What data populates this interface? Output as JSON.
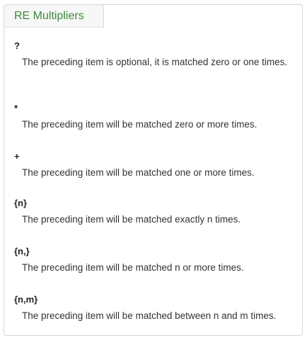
{
  "tab": {
    "title": "RE Multipliers"
  },
  "entries": [
    {
      "symbol": "?",
      "description": "The preceding item is optional, it is matched zero or one times."
    },
    {
      "symbol": "*",
      "description": "The preceding item will be matched zero or more times."
    },
    {
      "symbol": "+",
      "description": "The preceding item will be matched one or more times."
    },
    {
      "symbol": "{n}",
      "description": "The preceding item will be matched exactly n times."
    },
    {
      "symbol": "{n,}",
      "description": "The preceding item will be matched n or more times."
    },
    {
      "symbol": "{n,m}",
      "description": "The preceding item will be matched between n and m times."
    }
  ]
}
